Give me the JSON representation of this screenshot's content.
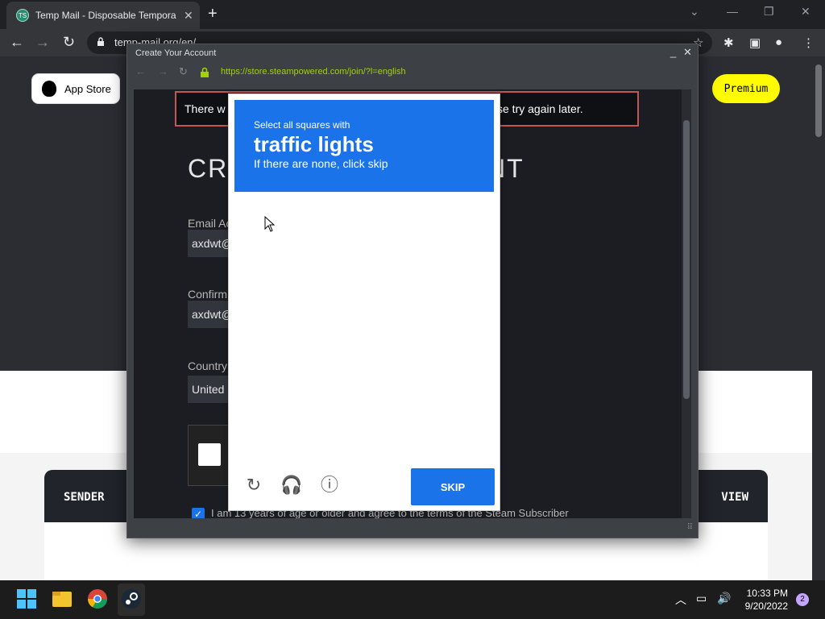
{
  "browser": {
    "tab_title": "Temp Mail - Disposable Tempora",
    "tab_favicon_text": "TS",
    "url": "temp-mail.org/en/"
  },
  "page": {
    "appstore_label": "App Store",
    "premium_label": "Premium",
    "sender_header": "SENDER",
    "view_header": "VIEW"
  },
  "dialog": {
    "title": "Create Your Account",
    "url": "https://store.steampowered.com/join/?l=english",
    "error_left": "There w",
    "error_right": "se try again later.",
    "heading_left": "CR",
    "heading_right": "NT",
    "email_label": "Email Ac",
    "email_value": "axdwt@",
    "confirm_label": "Confirm",
    "confirm_value": "axdwt@",
    "country_label": "Country",
    "country_value": "United",
    "agree_text": "I am 13 years of age or older and agree to the terms of the Steam Subscriber"
  },
  "captcha": {
    "subtitle": "Select all squares with",
    "object": "traffic lights",
    "note": "If there are none, click skip",
    "skip_label": "SKIP"
  },
  "taskbar": {
    "time": "10:33 PM",
    "date": "9/20/2022",
    "notification_count": "2"
  },
  "colors": {
    "captcha_blue": "#1a73e8",
    "steam_url_green": "#a4d007",
    "error_border": "#c15755",
    "premium_yellow": "#fffb00"
  }
}
